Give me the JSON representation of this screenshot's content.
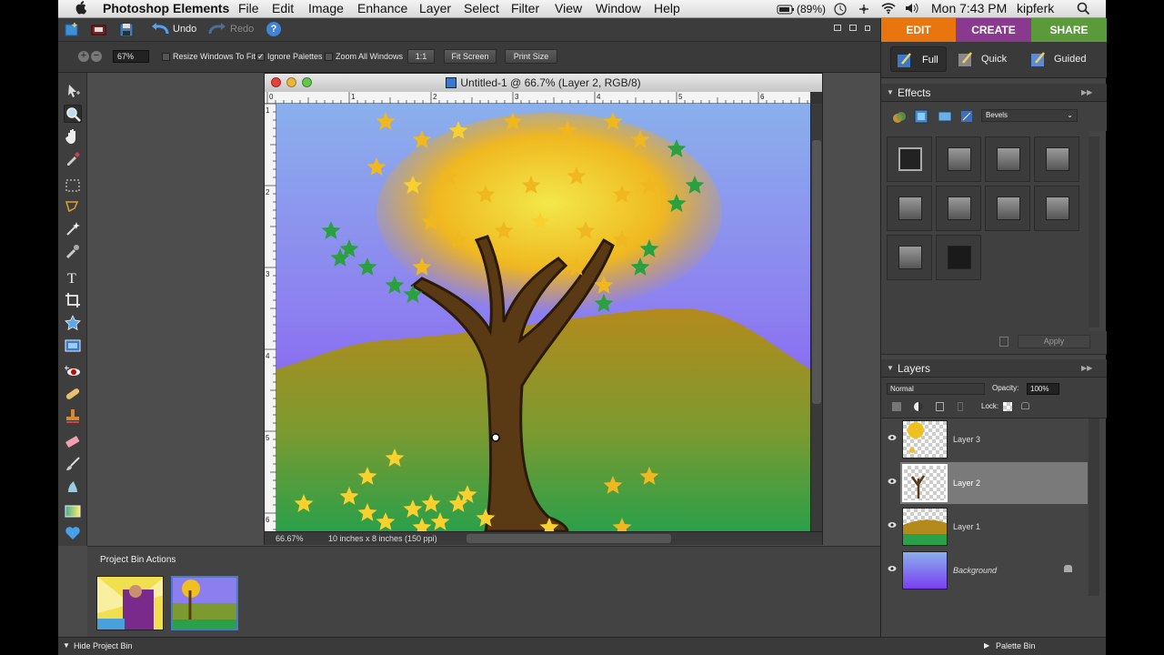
{
  "menubar": {
    "app_name": "Photoshop Elements",
    "menus": [
      "File",
      "Edit",
      "Image",
      "Enhance",
      "Layer",
      "Select",
      "Filter",
      "View",
      "Window",
      "Help"
    ],
    "battery": "(89%)",
    "clock": "Mon 7:43 PM",
    "user": "kipferk"
  },
  "topbar": {
    "undo": "Undo",
    "redo": "Redo",
    "help": "?"
  },
  "modes": {
    "edit": "EDIT",
    "create": "CREATE",
    "share": "SHARE"
  },
  "edit_modes": {
    "full": "Full",
    "quick": "Quick",
    "guided": "Guided"
  },
  "options": {
    "zoom": "67%",
    "resize_windows": "Resize Windows To Fit",
    "ignore_palettes": "Ignore Palettes",
    "zoom_all": "Zoom All Windows",
    "one_to_one": "1:1",
    "fit_screen": "Fit Screen",
    "print_size": "Print Size"
  },
  "document": {
    "title": "Untitled-1 @ 66.7% (Layer 2, RGB/8)",
    "zoom": "66.67%",
    "info": "10 inches x 8 inches (150 ppi)",
    "ruler_h": [
      "0",
      "1",
      "2",
      "3",
      "4",
      "5",
      "6"
    ],
    "ruler_v": [
      "1",
      "2",
      "3",
      "4",
      "5",
      "6"
    ]
  },
  "project_bin": {
    "title": "Project Bin Actions",
    "hide_label": "Hide Project Bin"
  },
  "effects": {
    "title": "Effects",
    "category": "Bevels",
    "apply": "Apply"
  },
  "layers": {
    "title": "Layers",
    "blend_mode": "Normal",
    "opacity_label": "Opacity:",
    "opacity": "100%",
    "lock_label": "Lock:",
    "items": [
      {
        "name": "Layer 3"
      },
      {
        "name": "Layer 2"
      },
      {
        "name": "Layer 1"
      },
      {
        "name": "Background"
      }
    ]
  },
  "palette_bin": "Palette Bin",
  "colors": {
    "edit_tab": "#e9750f",
    "create_tab": "#8a3a8e",
    "share_tab": "#5a9a3a",
    "selected_layer": "#7a7a7a",
    "sky_top": "#8ab0ec",
    "sky_bottom": "#7a3ff0",
    "hill": "#b48a1c",
    "grass": "#2aa04a",
    "trunk": "#5a3a14"
  },
  "icons": [
    "apple-icon",
    "new-file-icon",
    "open-icon",
    "save-icon",
    "undo-icon",
    "redo-icon",
    "help-icon",
    "zoom-tool-icon",
    "move-tool-icon",
    "hand-tool-icon",
    "eyedropper-tool-icon",
    "marquee-tool-icon",
    "lasso-tool-icon",
    "magic-wand-tool-icon",
    "brush-tool-icon",
    "type-tool-icon",
    "crop-tool-icon",
    "shape-tool-icon",
    "red-eye-tool-icon",
    "eraser-tool-icon",
    "gradient-tool-icon",
    "eye-icon",
    "lock-icon",
    "trash-icon"
  ]
}
